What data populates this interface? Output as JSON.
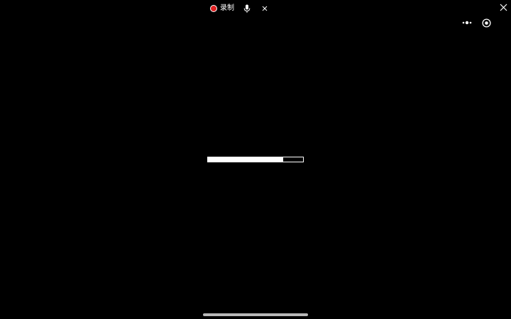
{
  "recording_bar": {
    "record_label": "录制",
    "record_color": "#e02020"
  },
  "icons": {
    "microphone": "microphone-icon",
    "stop_recording": "close-icon",
    "close_window": "close-icon",
    "more": "more-dots-icon",
    "exit": "target-circle-icon"
  },
  "loading": {
    "progress_percent": 79,
    "fill_color": "#ffffff",
    "track_border_color": "#ffffff"
  },
  "colors": {
    "background": "#000000",
    "foreground": "#ffffff",
    "home_indicator": "#b8b8b8"
  }
}
